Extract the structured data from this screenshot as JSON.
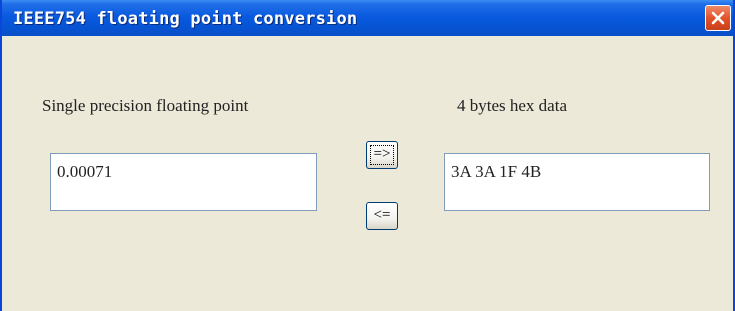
{
  "window": {
    "title": "IEEE754 floating point conversion"
  },
  "left": {
    "label": "Single precision floating point",
    "value": "0.00071"
  },
  "right": {
    "label": "4 bytes hex data",
    "value": "3A 3A 1F 4B"
  },
  "buttons": {
    "to_hex": "=>",
    "to_float": "<="
  },
  "icons": {
    "close": "close-icon"
  },
  "colors": {
    "titlebar": "#0a5ae0",
    "close_button": "#e2532a",
    "dialog_background": "#ece9d8"
  }
}
